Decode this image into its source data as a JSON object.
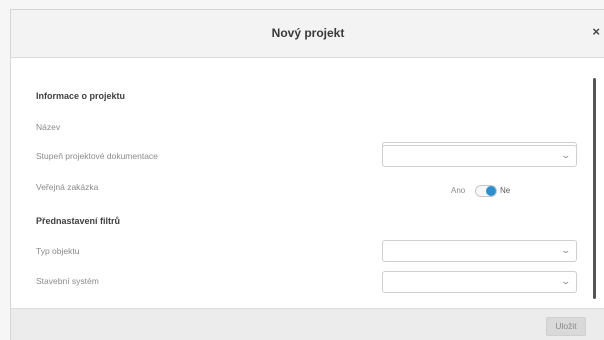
{
  "dialog": {
    "title": "Nový projekt",
    "close_icon": "×"
  },
  "sections": {
    "project_info": "Informace o projektu",
    "filter_presets": "Přednastavení filtrů"
  },
  "fields": {
    "name": {
      "label": "Název",
      "value": "",
      "placeholder": ""
    },
    "doc_level": {
      "label": "Stupeň projektové dokumentace",
      "value": ""
    },
    "public_tender": {
      "label": "Veřejná zakázka",
      "option_yes": "Ano",
      "option_no": "Ne",
      "selected": "Ne"
    },
    "object_type": {
      "label": "Typ objektu",
      "value": ""
    },
    "building_system": {
      "label": "Stavební systém",
      "value": ""
    }
  },
  "icons": {
    "chevron": "chevron-down-icon",
    "close": "close-icon"
  },
  "footer": {
    "save_label": "Uložit"
  },
  "colors": {
    "accent": "#2b8fcd",
    "header_bg": "#f3f3f3",
    "footer_bg": "#ececec"
  }
}
